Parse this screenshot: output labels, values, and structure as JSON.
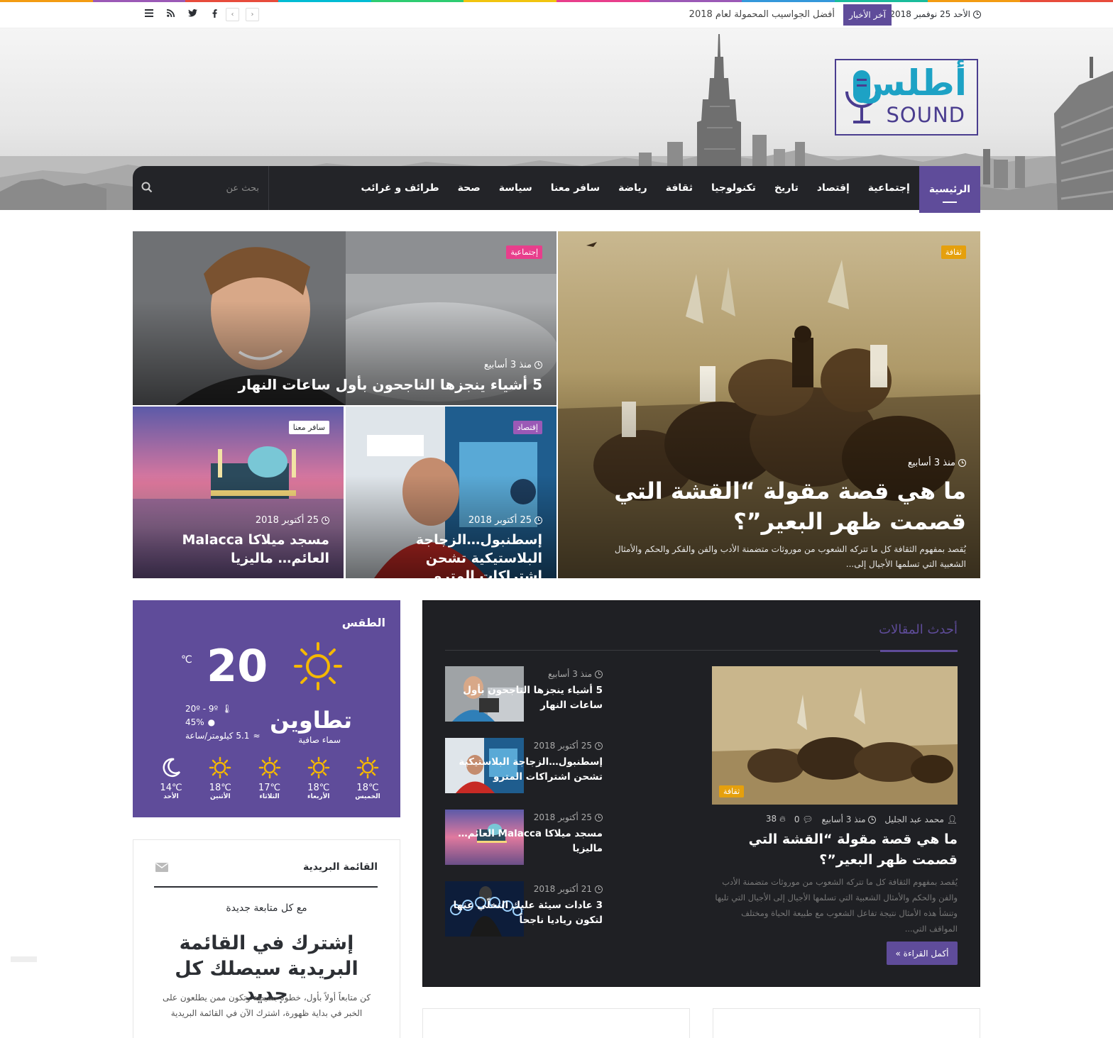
{
  "colors": {
    "accent": "#5f4c9a",
    "dark": "#232428",
    "culture_badge": "#e5a00d",
    "social_badge": "#e83e8c",
    "economy_badge": "#9b59b6",
    "travel_badge": "#ffffff",
    "brand_cyan": "#1da2c5"
  },
  "topbar": {
    "date": "الأحد 25 نوفمبر 2018",
    "breaking_label": "آخر الأخبار",
    "breaking_text": "أفضل الجواسيب المحمولة لعام 2018",
    "social_icons": [
      "menu-icon",
      "rss-icon",
      "twitter-icon",
      "facebook-icon"
    ]
  },
  "logo": {
    "arabic": "أطلس",
    "english": "SOUND"
  },
  "nav": {
    "items": [
      "الرئيسية",
      "إجتماعية",
      "إقتصاد",
      "تاريخ",
      "تكنولوجيا",
      "ثقافة",
      "رياضة",
      "سافر معنا",
      "سياسة",
      "صحة",
      "طرائف و غرائب"
    ],
    "search_placeholder": "بحث عن"
  },
  "hero": {
    "main": {
      "badge": "ثقافة",
      "time": "منذ 3 أسابيع",
      "title": "ما هي قصة مقولة “القشة التي قصمت ظهر البعير”؟",
      "excerpt": "يُقصد بمفهوم الثقافة كل ما تتركه الشعوب من موروثات متضمنة الأدب والفن والفكر والحكم والأمثال الشعبية التي تسلمها الأجيال إلى..."
    },
    "top_left": {
      "badge": "إجتماعية",
      "time": "منذ 3 أسابيع",
      "title": "5 أشياء ينجزها الناجحون بأول ساعات النهار"
    },
    "mid": {
      "badge": "إقتصاد",
      "time": "25 أكتوبر 2018",
      "title": "إسطنبول…الزجاجة البلاستيكية تشحن اشتراكات المترو"
    },
    "left": {
      "badge": "سافر معنا",
      "time": "25 أكتوبر 2018",
      "title": "مسجد ميلاكا Malacca العائم… ماليزيا"
    }
  },
  "weather": {
    "title": "الطقس",
    "temp": "20",
    "unit": "℃",
    "city": "تطاوين",
    "desc": "سماء صافية",
    "range": "20º - 9º",
    "humidity": "45%",
    "wind": "5.1 كيلومتر/ساعة",
    "forecast": [
      {
        "day": "الأحد",
        "temp": "14",
        "icon": "moon-icon"
      },
      {
        "day": "الأثنين",
        "temp": "18",
        "icon": "sun-icon"
      },
      {
        "day": "الثلاثاء",
        "temp": "17",
        "icon": "sun-icon"
      },
      {
        "day": "الأربعاء",
        "temp": "18",
        "icon": "sun-icon"
      },
      {
        "day": "الخميس",
        "temp": "18",
        "icon": "sun-icon"
      }
    ]
  },
  "newsletter": {
    "heading": "القائمة البريدية",
    "subtitle": "مع كل متابعة جديدة",
    "big": "إشترك في القائمة البريدية سيصلك كل جديد",
    "text": "كن متابعاً أولاً بأول، خطوة بسيطة وتكون ممن يطلعون على الخبر في بداية ظهورة، اشترك الآن في القائمة البريدية"
  },
  "recent": {
    "heading": "أحدث المقالات",
    "featured": {
      "badge": "ثقافة",
      "author": "محمد عبد الجليل",
      "time": "منذ 3 أسابيع",
      "comments": "0",
      "views": "38",
      "title": "ما هي قصة مقولة “القشة التي قصمت ظهر البعير”؟",
      "excerpt": "يُقصد بمفهوم الثقافة كل ما تتركه الشعوب من موروثات متضمنة الأدب والفن والحكم والأمثال الشعبية التي تسلمها الأجيال إلى الأجيال التي تليها وتنشأ هذه الأمثال نتيجة تفاعل الشعوب مع طبيعة الحياة ومختلف المواقف التي...",
      "more": "أكمل القراءة »"
    },
    "items": [
      {
        "time": "منذ 3 أسابيع",
        "title": "5 أشياء ينجزها الناجحون بأول ساعات النهار"
      },
      {
        "time": "25 أكتوبر 2018",
        "title": "إسطنبول…الزجاجة البلاستيكية تشحن اشتراكات المترو"
      },
      {
        "time": "25 أكتوبر 2018",
        "title": "مسجد ميلاكا Malacca العائم…ماليزيا"
      },
      {
        "time": "21 أكتوبر 2018",
        "title": "3 عادات سيئة عليك التخلّي عنها لتكون رياديا ناجحاً"
      }
    ]
  }
}
